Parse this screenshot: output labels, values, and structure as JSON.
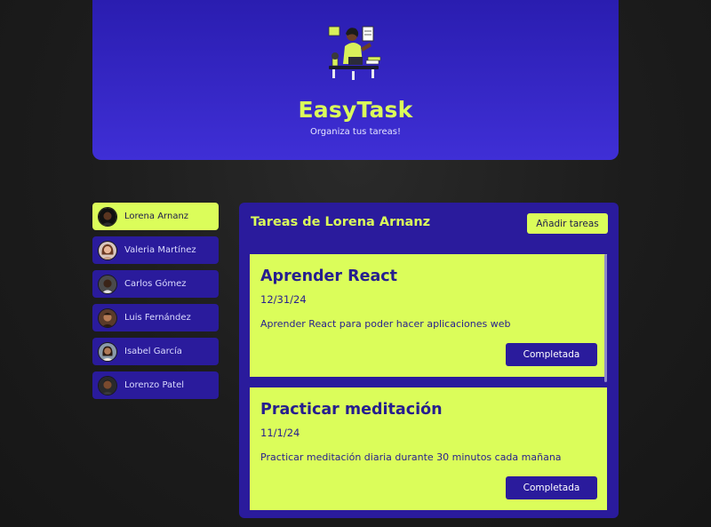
{
  "header": {
    "title": "EasyTask",
    "subtitle": "Organiza tus tareas!",
    "logo_icon": "task-organizer-illustration-icon"
  },
  "colors": {
    "accent": "#dbfd5a",
    "primary": "#2a1b9c",
    "header_gradient_top": "#2a1db0",
    "header_gradient_bottom": "#3f2fd6"
  },
  "users": [
    {
      "name": "Lorena Arnanz",
      "active": true
    },
    {
      "name": "Valeria Martínez",
      "active": false
    },
    {
      "name": "Carlos Gómez",
      "active": false
    },
    {
      "name": "Luis Fernández",
      "active": false
    },
    {
      "name": "Isabel García",
      "active": false
    },
    {
      "name": "Lorenzo Patel",
      "active": false
    }
  ],
  "tasks_panel": {
    "title": "Tareas de Lorena Arnanz",
    "add_label": "Añadir tareas",
    "tasks": [
      {
        "title": "Aprender React",
        "date": "12/31/24",
        "description": "Aprender React para poder hacer aplicaciones web",
        "button": "Completada"
      },
      {
        "title": "Practicar meditación",
        "date": "11/1/24",
        "description": "Practicar meditación diaria durante 30 minutos cada mañana",
        "button": "Completada"
      }
    ]
  }
}
